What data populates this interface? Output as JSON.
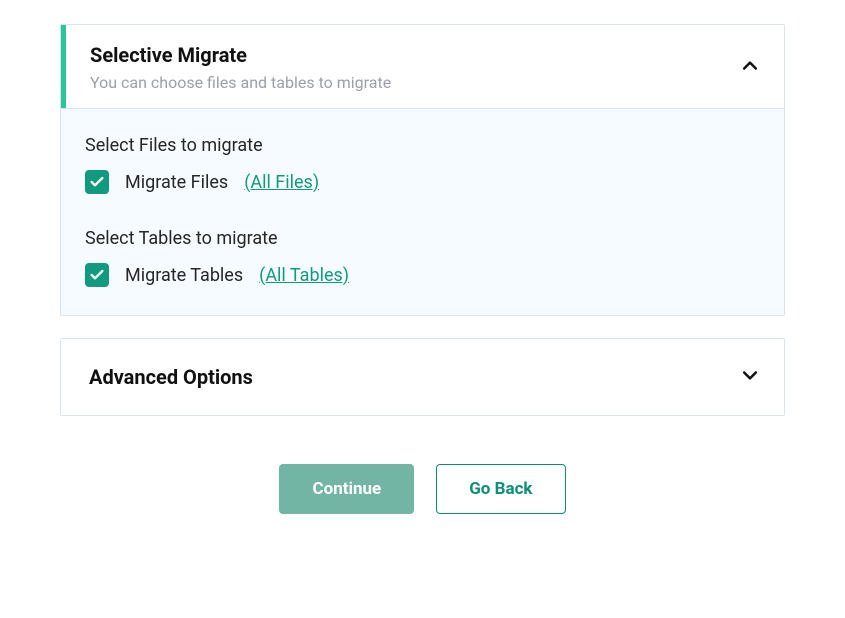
{
  "selectiveMigrate": {
    "title": "Selective Migrate",
    "subtitle": "You can choose files and tables to migrate",
    "filesSection": {
      "label": "Select Files to migrate",
      "checkboxLabel": "Migrate Files",
      "link": "(All Files)"
    },
    "tablesSection": {
      "label": "Select Tables to migrate",
      "checkboxLabel": "Migrate Tables",
      "link": "(All Tables)"
    }
  },
  "advancedOptions": {
    "title": "Advanced Options"
  },
  "buttons": {
    "continue": "Continue",
    "goBack": "Go Back"
  }
}
